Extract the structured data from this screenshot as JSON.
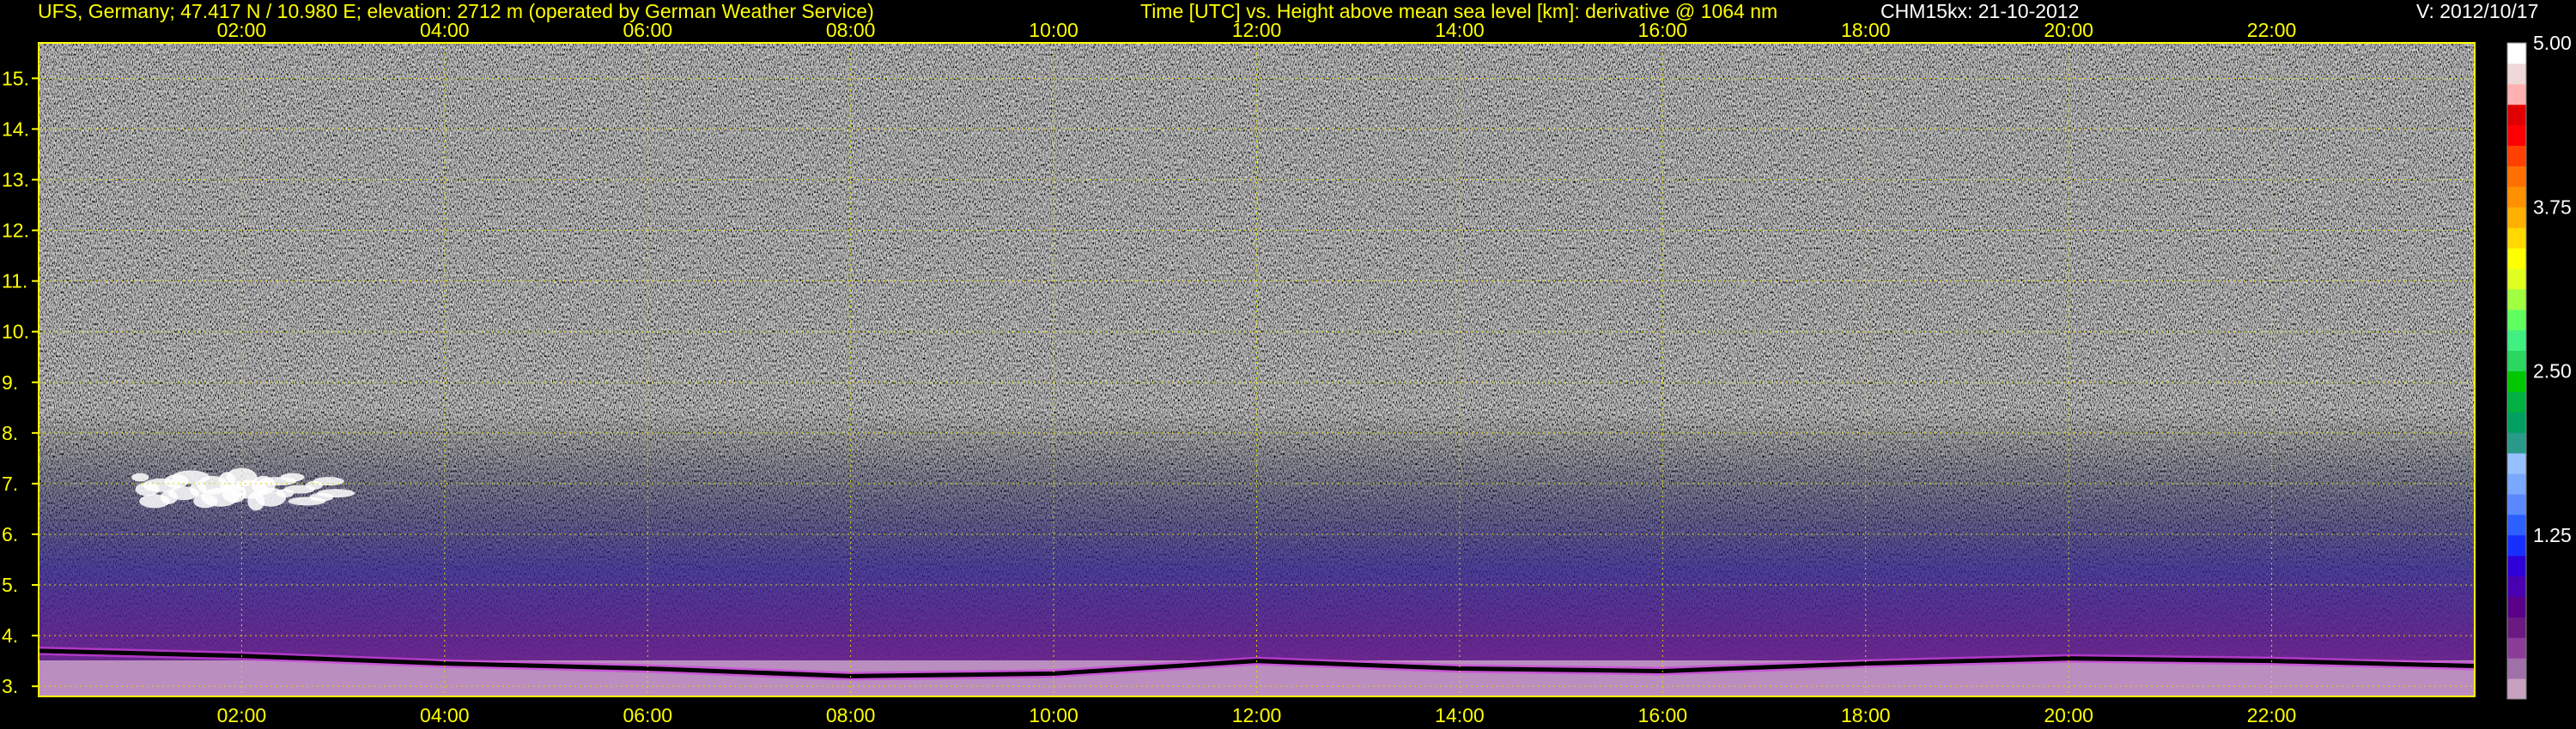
{
  "header": {
    "station": "UFS, Germany; 47.417 N / 10.980 E; elevation: 2712 m  (operated by German Weather Service)",
    "axes_desc": "Time [UTC] vs. Height above mean sea level [km]: derivative @ 1064 nm",
    "instrument": "CHM15kx: 21-10-2012",
    "version": "V: 2012/10/17"
  },
  "chart_data": {
    "type": "heatmap",
    "title": "Time [UTC] vs. Height above mean sea level [km]: derivative @ 1064 nm",
    "xlabel": "Time [UTC]",
    "ylabel": "Height above mean sea level [km]",
    "x_ticks": [
      "02:00",
      "04:00",
      "06:00",
      "08:00",
      "10:00",
      "12:00",
      "14:00",
      "16:00",
      "18:00",
      "20:00",
      "22:00"
    ],
    "x_tick_hours": [
      2,
      4,
      6,
      8,
      10,
      12,
      14,
      16,
      18,
      20,
      22
    ],
    "xlim": [
      0,
      24
    ],
    "y_ticks": [
      "3.",
      "4.",
      "5.",
      "6.",
      "7.",
      "8.",
      "9.",
      "10.",
      "11.",
      "12.",
      "13.",
      "14.",
      "15."
    ],
    "y_tick_values": [
      3,
      4,
      5,
      6,
      7,
      8,
      9,
      10,
      11,
      12,
      13,
      14,
      15
    ],
    "ylim": [
      2.8,
      15.7
    ],
    "grid": true,
    "colorbar": {
      "ticks": [
        "5.00",
        "3.75",
        "2.50",
        "1.25"
      ],
      "tick_values": [
        5.0,
        3.75,
        2.5,
        1.25
      ],
      "range": [
        0,
        5.0
      ],
      "colors": [
        "#c8a0c0",
        "#a070a8",
        "#8a3c98",
        "#6a1a80",
        "#5a0088",
        "#4a00b0",
        "#3000d8",
        "#1830ff",
        "#2c60ff",
        "#5a88ff",
        "#7aa8ff",
        "#96c0ff",
        "#2a9a8a",
        "#00a060",
        "#00b040",
        "#00c800",
        "#2ad860",
        "#40f080",
        "#60ff60",
        "#a0ff40",
        "#e0ff20",
        "#ffff00",
        "#ffd800",
        "#ffb000",
        "#ff9000",
        "#ff7000",
        "#ff4000",
        "#ff0000",
        "#e00000",
        "#ffb0b0",
        "#f0d8d8",
        "#ffffff"
      ]
    },
    "features": [
      {
        "name": "cloud",
        "x_range": [
          1.0,
          3.0
        ],
        "y_range": [
          6.3,
          7.4
        ]
      },
      {
        "name": "boundary_layer_top",
        "x": [
          0,
          2,
          4,
          6,
          8,
          10,
          12,
          14,
          16,
          18,
          20,
          22,
          24
        ],
        "y": [
          3.7,
          3.6,
          3.45,
          3.35,
          3.2,
          3.25,
          3.5,
          3.35,
          3.3,
          3.45,
          3.55,
          3.5,
          3.4
        ]
      }
    ]
  }
}
